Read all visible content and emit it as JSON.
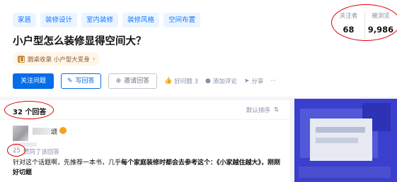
{
  "question": {
    "tags": [
      "家居",
      "装修设计",
      "室内装修",
      "装修风格",
      "空间布置"
    ],
    "title": "小户型怎么装修显得空间大？",
    "collection": {
      "label": "圆桌收录 小户型大变身",
      "arrow": "›"
    },
    "actions": {
      "follow": "关注问题",
      "write": "写回答",
      "invite": "邀请回答",
      "good": "好问题 3",
      "comment": "添加评论",
      "share": "分享",
      "more": "···"
    },
    "stats": {
      "followers_label": "关注者",
      "followers_value": "68",
      "views_label": "被浏览",
      "views_value": "9,986"
    }
  },
  "answers": {
    "count": "32 个回答",
    "sort": "默认排序",
    "sort_icon": "⇅",
    "first": {
      "author_name_visible": "颂",
      "vote_count": "25",
      "vote_text": "赞同了该回答",
      "excerpt_plain": "针对这个话题啊，先推荐一本书，几乎",
      "excerpt_bold": "每个家庭装修时都会去参考这个：《小家越住越大》，刚刚",
      "excerpt_tail": "好切题"
    }
  },
  "icons": {
    "write": "pencil-icon",
    "invite": "invite-user-icon",
    "good": "thumbs-up-icon",
    "comment": "comment-icon",
    "share": "share-icon",
    "more": "more-icon",
    "collection": "collection-icon",
    "sort": "sort-icon"
  },
  "colors": {
    "primary": "#056de8",
    "tag_bg": "#ebf5ff",
    "annotation": "#e00000"
  }
}
